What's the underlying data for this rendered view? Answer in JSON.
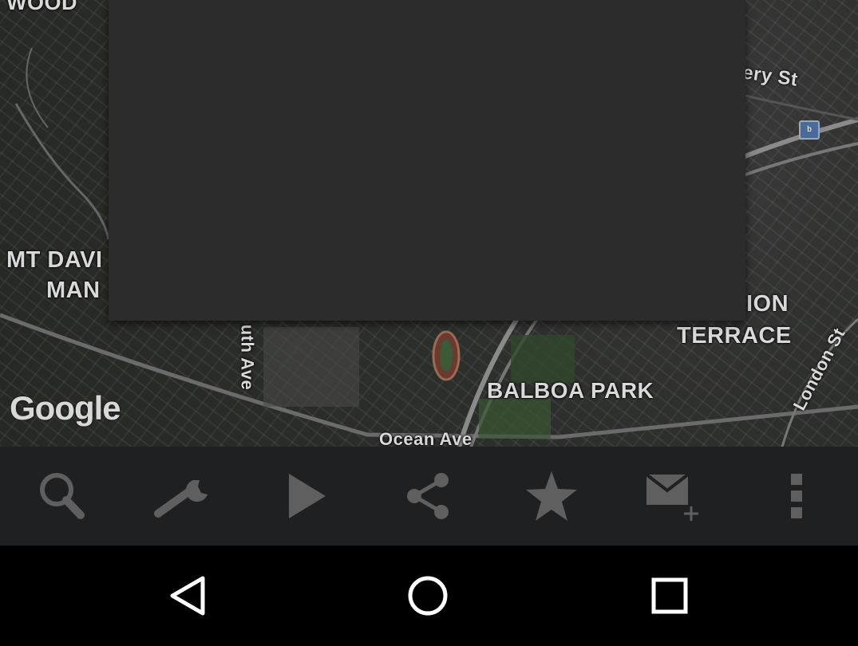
{
  "map": {
    "labels": {
      "wood": "WOOD",
      "street_st": "ery St",
      "mt_davidson_1": "MT DAVI",
      "mt_davidson_2": "MAN",
      "union_1": "ION",
      "terrace": "TERRACE",
      "london_st": "London St",
      "south_ave": "uth Ave",
      "balboa_park": "BALBOA PARK",
      "ocean_ave": "Ocean Ave"
    },
    "attribution": "Google",
    "transit_badge": "b"
  },
  "dialog": {},
  "toolbar": {
    "icons": [
      "search-icon",
      "wrench-icon",
      "play-icon",
      "share-icon",
      "star-icon",
      "email-add-icon",
      "overflow-menu-icon"
    ]
  },
  "navbar": {
    "icons": [
      "back-icon",
      "home-icon",
      "recents-icon"
    ]
  },
  "colors": {
    "icon": "#5f5f5f",
    "toolbar_bg": "#1f2021",
    "dialog_bg": "#2c2c2c",
    "nav_icon": "#ffffff"
  }
}
